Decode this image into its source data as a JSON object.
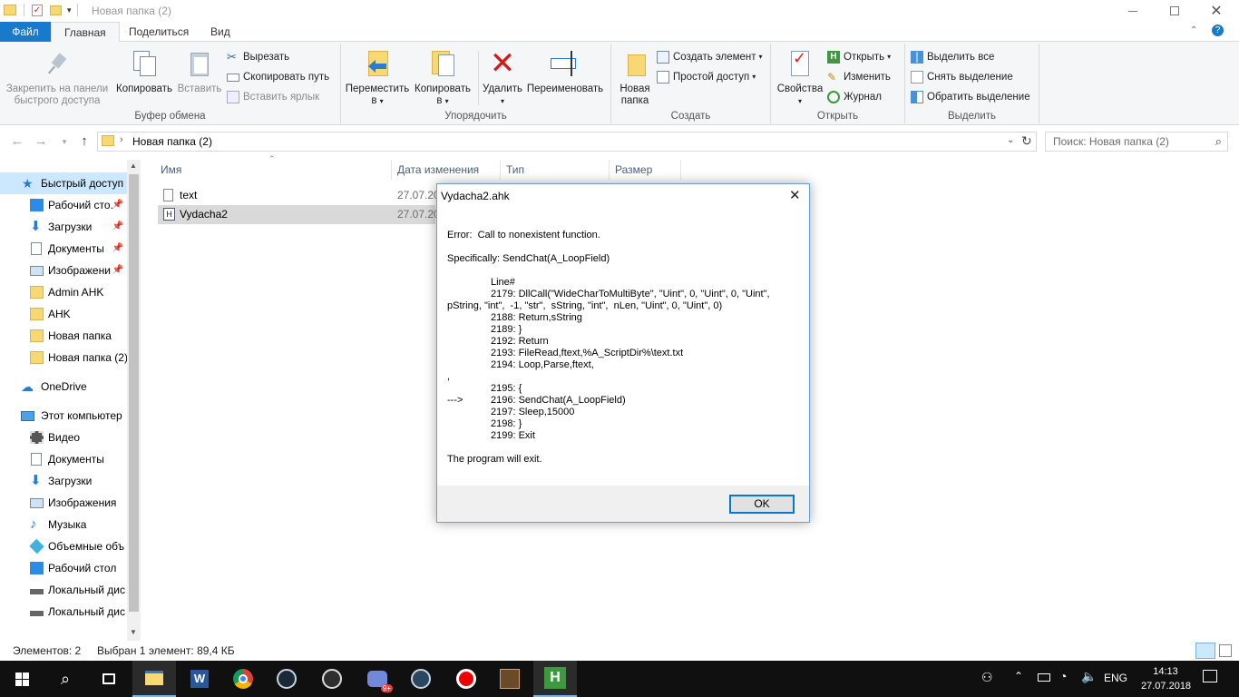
{
  "window": {
    "title": "Новая папка (2)"
  },
  "ribbon_tabs": [
    "Файл",
    "Главная",
    "Поделиться",
    "Вид"
  ],
  "ribbon": {
    "clipboard": {
      "pin": "Закрепить на панели быстрого доступа",
      "pin_l1": "Закрепить на панели",
      "pin_l2": "быстрого доступа",
      "copy": "Копировать",
      "paste": "Вставить",
      "cut": "Вырезать",
      "copy_path": "Скопировать путь",
      "paste_shortcut": "Вставить ярлык",
      "label": "Буфер обмена"
    },
    "organize": {
      "move_l1": "Переместить",
      "move_l2": "в",
      "copy_l1": "Копировать",
      "copy_l2": "в",
      "delete": "Удалить",
      "rename": "Переименовать",
      "label": "Упорядочить"
    },
    "create": {
      "new_folder_l1": "Новая",
      "new_folder_l2": "папка",
      "new_item": "Создать элемент",
      "easy_access": "Простой доступ",
      "label": "Создать"
    },
    "open": {
      "properties": "Свойства",
      "open": "Открыть",
      "edit": "Изменить",
      "history": "Журнал",
      "label": "Открыть"
    },
    "select": {
      "select_all": "Выделить все",
      "select_none": "Снять выделение",
      "invert": "Обратить выделение",
      "label": "Выделить"
    }
  },
  "address": {
    "path": "Новая папка (2)",
    "search_placeholder": "Поиск: Новая папка (2)"
  },
  "nav": [
    {
      "label": "Быстрый доступ",
      "icon": "star-icon",
      "pinned": false
    },
    {
      "label": "Рабочий сто.",
      "icon": "desktop-icon",
      "pinned": true
    },
    {
      "label": "Загрузки",
      "icon": "download-icon",
      "pinned": true
    },
    {
      "label": "Документы",
      "icon": "documents-icon",
      "pinned": true
    },
    {
      "label": "Изображени",
      "icon": "pictures-icon",
      "pinned": true
    },
    {
      "label": "Admin AHK",
      "icon": "folder-icon",
      "pinned": false
    },
    {
      "label": "AHK",
      "icon": "folder-icon",
      "pinned": false
    },
    {
      "label": "Новая папка",
      "icon": "folder-icon",
      "pinned": false
    },
    {
      "label": "Новая папка (2)",
      "icon": "folder-icon",
      "pinned": false
    },
    {
      "label": "OneDrive",
      "icon": "cloud-icon",
      "pinned": false
    },
    {
      "label": "Этот компьютер",
      "icon": "computer-icon",
      "pinned": false
    },
    {
      "label": "Видео",
      "icon": "video-icon",
      "pinned": false
    },
    {
      "label": "Документы",
      "icon": "documents-icon",
      "pinned": false
    },
    {
      "label": "Загрузки",
      "icon": "download-icon",
      "pinned": false
    },
    {
      "label": "Изображения",
      "icon": "pictures-icon",
      "pinned": false
    },
    {
      "label": "Музыка",
      "icon": "music-icon",
      "pinned": false
    },
    {
      "label": "Объемные объ",
      "icon": "3d-objects-icon",
      "pinned": false
    },
    {
      "label": "Рабочий стол",
      "icon": "desktop-icon",
      "pinned": false
    },
    {
      "label": "Локальный дис",
      "icon": "drive-icon",
      "pinned": false
    },
    {
      "label": "Локальный дис",
      "icon": "drive-icon",
      "pinned": false
    }
  ],
  "columns": {
    "name": "Имя",
    "date": "Дата изменения",
    "type": "Тип",
    "size": "Размер"
  },
  "files": [
    {
      "name": "text",
      "date": "27.07.20",
      "icon": "text-file-icon"
    },
    {
      "name": "Vydacha2",
      "date": "27.07.20",
      "icon": "ahk-file-icon"
    }
  ],
  "status": {
    "count": "Элементов: 2",
    "selection": "Выбран 1 элемент: 89,4 КБ"
  },
  "dialog": {
    "title": "Vydacha2.ahk",
    "error": "Error:  Call to nonexistent function.",
    "specifically": "Specifically: SendChat(A_LoopField)",
    "line_header": "Line#",
    "lines": [
      "2179: DllCall(\"WideCharToMultiByte\", \"Uint\", 0, \"Uint\", 0, \"Uint\",",
      "pString, \"int\",  -1, \"str\",  sString, \"int\",  nLen, \"Uint\", 0, \"Uint\", 0)",
      "2188: Return,sString",
      "2189: }",
      "2192: Return",
      "2193: FileRead,ftext,%A_ScriptDir%\\text.txt",
      "2194: Loop,Parse,ftext,",
      ",",
      "2195: {",
      "2196: SendChat(A_LoopField)",
      "2197: Sleep,15000",
      "2198: }",
      "2199: Exit"
    ],
    "arrow": "--->",
    "footer": "The program will exit.",
    "ok": "OK"
  },
  "taskbar": {
    "lang": "ENG",
    "time": "14:13",
    "date": "27.07.2018"
  },
  "colors": {
    "accent": "#1979ca",
    "selection": "#d9d9d9",
    "folder": "#f8d775",
    "taskbar": "#101010"
  }
}
